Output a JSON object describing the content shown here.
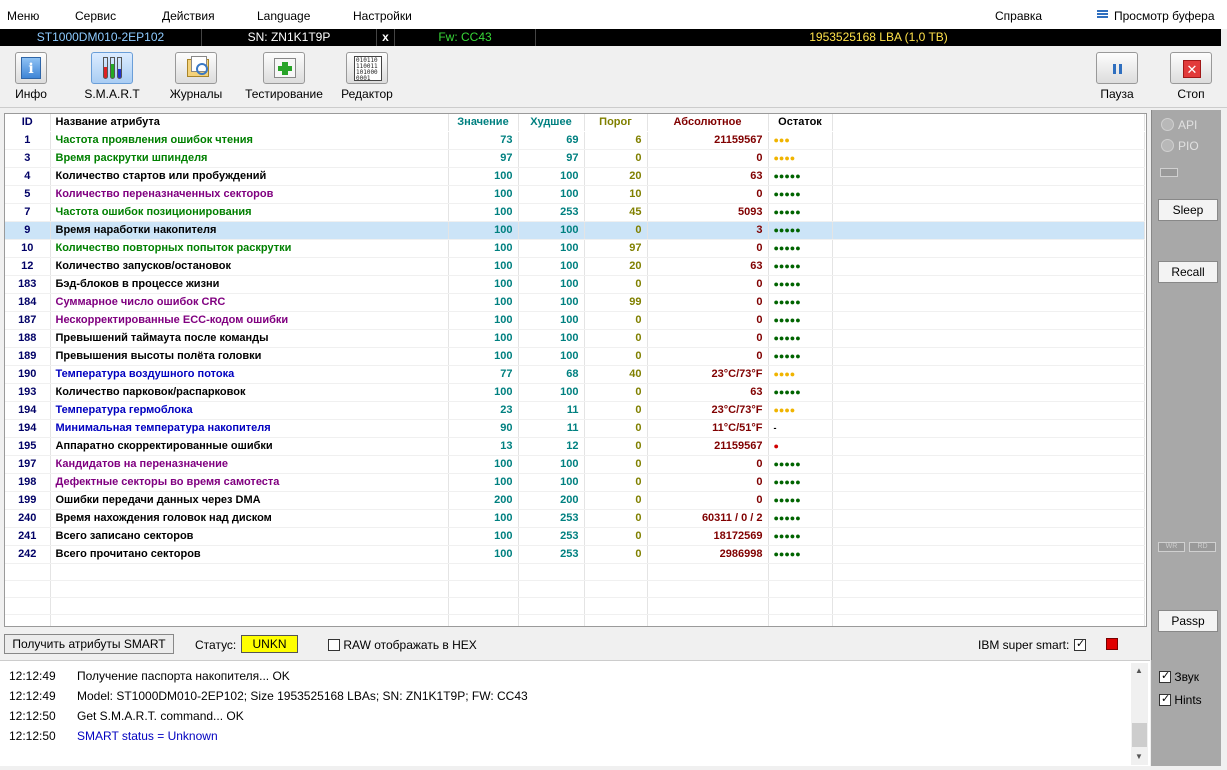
{
  "menu": {
    "items": [
      "Меню",
      "Сервис",
      "Действия",
      "Language",
      "Настройки"
    ],
    "help": "Справка",
    "buffer": "Просмотр буфера"
  },
  "drive": {
    "model": "ST1000DM010-2EP102",
    "serial": "SN: ZN1K1T9P",
    "close": "x",
    "firmware": "Fw: CC43",
    "capacity": "1953525168 LBA (1,0 TB)"
  },
  "toolbar": {
    "info": "Инфо",
    "smart": "S.M.A.R.T",
    "logs": "Журналы",
    "testing": "Тестирование",
    "editor": "Редактор",
    "pause": "Пауза",
    "stop": "Стоп"
  },
  "table": {
    "headers": {
      "id": "ID",
      "name": "Название атрибута",
      "value": "Значение",
      "worst": "Худшее",
      "threshold": "Порог",
      "raw": "Абсолютное",
      "remaining": "Остаток"
    },
    "colors": {
      "green": "#008000",
      "black": "#000000",
      "purple": "#800080",
      "blue": "#0000c0",
      "dot_green": "#006400",
      "dot_yellow": "#f0b400",
      "dot_red": "#d00000"
    },
    "rows": [
      {
        "id": "1",
        "name": "Частота проявления ошибок чтения",
        "value": "73",
        "worst": "69",
        "threshold": "6",
        "raw": "21159567",
        "dots": "●●●",
        "color": "green",
        "dot_color": "dot_yellow"
      },
      {
        "id": "3",
        "name": "Время раскрутки шпинделя",
        "value": "97",
        "worst": "97",
        "threshold": "0",
        "raw": "0",
        "dots": "●●●●",
        "color": "green",
        "dot_color": "dot_yellow"
      },
      {
        "id": "4",
        "name": "Количество стартов или пробуждений",
        "value": "100",
        "worst": "100",
        "threshold": "20",
        "raw": "63",
        "dots": "●●●●●",
        "color": "black",
        "dot_color": "dot_green"
      },
      {
        "id": "5",
        "name": "Количество переназначенных секторов",
        "value": "100",
        "worst": "100",
        "threshold": "10",
        "raw": "0",
        "dots": "●●●●●",
        "color": "purple",
        "dot_color": "dot_green"
      },
      {
        "id": "7",
        "name": "Частота ошибок позиционирования",
        "value": "100",
        "worst": "253",
        "threshold": "45",
        "raw": "5093",
        "dots": "●●●●●",
        "color": "green",
        "dot_color": "dot_green"
      },
      {
        "id": "9",
        "name": "Время наработки накопителя",
        "value": "100",
        "worst": "100",
        "threshold": "0",
        "raw": "3",
        "dots": "●●●●●",
        "color": "black",
        "dot_color": "dot_green",
        "selected": true
      },
      {
        "id": "10",
        "name": "Количество повторных попыток раскрутки",
        "value": "100",
        "worst": "100",
        "threshold": "97",
        "raw": "0",
        "dots": "●●●●●",
        "color": "green",
        "dot_color": "dot_green"
      },
      {
        "id": "12",
        "name": "Количество запусков/остановок",
        "value": "100",
        "worst": "100",
        "threshold": "20",
        "raw": "63",
        "dots": "●●●●●",
        "color": "black",
        "dot_color": "dot_green"
      },
      {
        "id": "183",
        "name": "Бэд-блоков в процессе жизни",
        "value": "100",
        "worst": "100",
        "threshold": "0",
        "raw": "0",
        "dots": "●●●●●",
        "color": "black",
        "dot_color": "dot_green"
      },
      {
        "id": "184",
        "name": "Суммарное число ошибок CRC",
        "value": "100",
        "worst": "100",
        "threshold": "99",
        "raw": "0",
        "dots": "●●●●●",
        "color": "purple",
        "dot_color": "dot_green"
      },
      {
        "id": "187",
        "name": "Нескорректированные ECC-кодом ошибки",
        "value": "100",
        "worst": "100",
        "threshold": "0",
        "raw": "0",
        "dots": "●●●●●",
        "color": "purple",
        "dot_color": "dot_green"
      },
      {
        "id": "188",
        "name": "Превышений таймаута после команды",
        "value": "100",
        "worst": "100",
        "threshold": "0",
        "raw": "0",
        "dots": "●●●●●",
        "color": "black",
        "dot_color": "dot_green"
      },
      {
        "id": "189",
        "name": "Превышения высоты полёта головки",
        "value": "100",
        "worst": "100",
        "threshold": "0",
        "raw": "0",
        "dots": "●●●●●",
        "color": "black",
        "dot_color": "dot_green"
      },
      {
        "id": "190",
        "name": "Температура воздушного потока",
        "value": "77",
        "worst": "68",
        "threshold": "40",
        "raw": "23°C/73°F",
        "dots": "●●●●",
        "color": "blue",
        "dot_color": "dot_yellow"
      },
      {
        "id": "193",
        "name": "Количество парковок/распарковок",
        "value": "100",
        "worst": "100",
        "threshold": "0",
        "raw": "63",
        "dots": "●●●●●",
        "color": "black",
        "dot_color": "dot_green"
      },
      {
        "id": "194",
        "name": "Температура гермоблока",
        "value": "23",
        "worst": "11",
        "threshold": "0",
        "raw": "23°C/73°F",
        "dots": "●●●●",
        "color": "blue",
        "dot_color": "dot_yellow"
      },
      {
        "id": "194",
        "name": "Минимальная температура накопителя",
        "value": "90",
        "worst": "11",
        "threshold": "0",
        "raw": "11°C/51°F",
        "dots": "-",
        "color": "blue",
        "dot_color": "black"
      },
      {
        "id": "195",
        "name": "Аппаратно скорректированные ошибки",
        "value": "13",
        "worst": "12",
        "threshold": "0",
        "raw": "21159567",
        "dots": "●",
        "color": "black",
        "dot_color": "dot_red"
      },
      {
        "id": "197",
        "name": "Кандидатов на переназначение",
        "value": "100",
        "worst": "100",
        "threshold": "0",
        "raw": "0",
        "dots": "●●●●●",
        "color": "purple",
        "dot_color": "dot_green"
      },
      {
        "id": "198",
        "name": "Дефектные секторы во время самотеста",
        "value": "100",
        "worst": "100",
        "threshold": "0",
        "raw": "0",
        "dots": "●●●●●",
        "color": "purple",
        "dot_color": "dot_green"
      },
      {
        "id": "199",
        "name": "Ошибки передачи данных через DMA",
        "value": "200",
        "worst": "200",
        "threshold": "0",
        "raw": "0",
        "dots": "●●●●●",
        "color": "black",
        "dot_color": "dot_green"
      },
      {
        "id": "240",
        "name": "Время нахождения головок над диском",
        "value": "100",
        "worst": "253",
        "threshold": "0",
        "raw": "60311 / 0 / 2",
        "dots": "●●●●●",
        "color": "black",
        "dot_color": "dot_green"
      },
      {
        "id": "241",
        "name": "Всего записано секторов",
        "value": "100",
        "worst": "253",
        "threshold": "0",
        "raw": "18172569",
        "dots": "●●●●●",
        "color": "black",
        "dot_color": "dot_green"
      },
      {
        "id": "242",
        "name": "Всего прочитано секторов",
        "value": "100",
        "worst": "253",
        "threshold": "0",
        "raw": "2986998",
        "dots": "●●●●●",
        "color": "black",
        "dot_color": "dot_green"
      }
    ]
  },
  "right_panel": {
    "api": "API",
    "pio": "PIO",
    "sleep": "Sleep",
    "recall": "Recall",
    "wr": "WR",
    "rd": "RD",
    "passp": "Passp"
  },
  "bottom": {
    "get_smart": "Получить атрибуты SMART",
    "status_label": "Статус:",
    "status_value": "UNKN",
    "raw_hex": "RAW отображать в HEX",
    "ibm": "IBM super smart:"
  },
  "log": [
    {
      "time": "12:12:49",
      "text": "Получение паспорта накопителя... OK",
      "color": "#000000"
    },
    {
      "time": "12:12:49",
      "text": "Model: ST1000DM010-2EP102; Size 1953525168 LBAs; SN: ZN1K1T9P; FW: CC43",
      "color": "#000000"
    },
    {
      "time": "12:12:50",
      "text": "Get S.M.A.R.T. command... OK",
      "color": "#000000"
    },
    {
      "time": "12:12:50",
      "text": "SMART status = Unknown",
      "color": "#0000c0"
    }
  ],
  "log_options": {
    "sound": "Звук",
    "hints": "Hints"
  }
}
